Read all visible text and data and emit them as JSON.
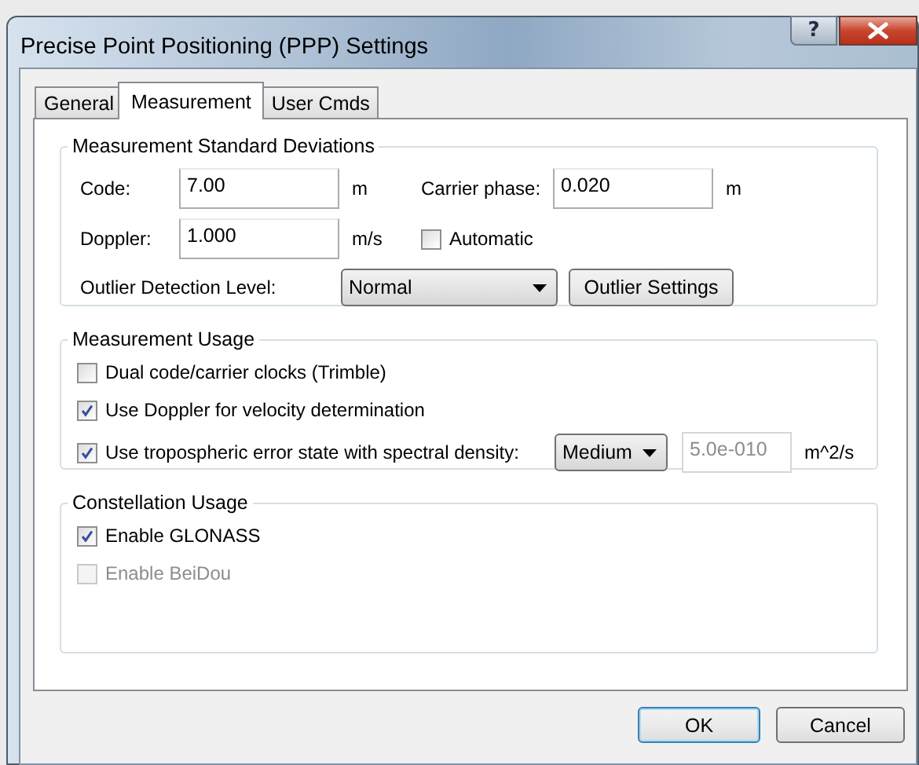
{
  "window": {
    "title": "Precise Point Positioning (PPP) Settings",
    "help_button": "?"
  },
  "tabs": [
    {
      "label": "General",
      "selected": false
    },
    {
      "label": "Measurement",
      "selected": true
    },
    {
      "label": "User Cmds",
      "selected": false
    }
  ],
  "standard_deviations": {
    "title": "Measurement Standard Deviations",
    "code": {
      "label": "Code:",
      "value": "7.00",
      "unit": "m"
    },
    "carrier_phase": {
      "label": "Carrier phase:",
      "value": "0.020",
      "unit": "m"
    },
    "doppler": {
      "label": "Doppler:",
      "value": "1.000",
      "unit": "m/s"
    },
    "automatic": {
      "label": "Automatic",
      "checked": false
    },
    "outlier_level": {
      "label": "Outlier Detection Level:",
      "value": "Normal"
    },
    "outlier_button": "Outlier Settings"
  },
  "usage": {
    "title": "Measurement Usage",
    "options": [
      {
        "kind": "checkbox",
        "label": "Dual code/carrier clocks (Trimble)",
        "checked": false
      },
      {
        "kind": "checkbox",
        "label": "Use Doppler for velocity determination",
        "checked": true
      },
      {
        "kind": "density",
        "label": "Use tropospheric error state with spectral density:",
        "checked": true,
        "level_value": "Medium",
        "density_value": "5.0e-010",
        "density_disabled": true,
        "unit": "m^2/s"
      }
    ]
  },
  "constellation": {
    "title": "Constellation Usage",
    "options": [
      {
        "label": "Enable GLONASS",
        "checked": true,
        "disabled": false
      },
      {
        "label": "Enable BeiDou",
        "checked": false,
        "disabled": true
      }
    ]
  },
  "buttons": [
    {
      "label": "OK",
      "default": true
    },
    {
      "label": "Cancel",
      "default": false
    }
  ]
}
